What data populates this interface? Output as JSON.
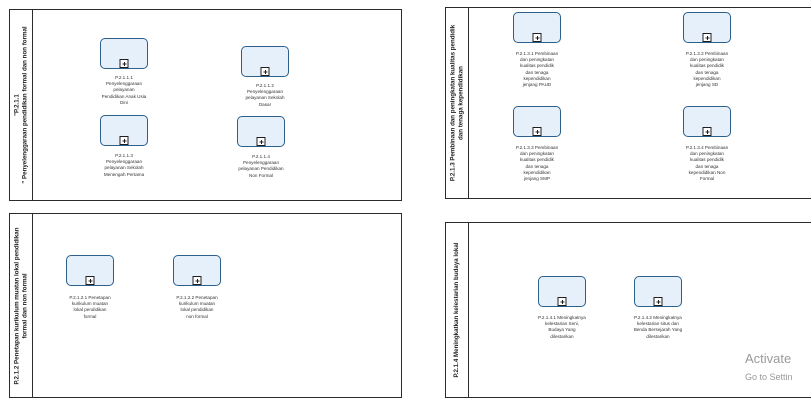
{
  "pools": [
    {
      "label": "\"P.2.1.1\n\" Penyelenggaraan pendidikan formal dan non formal",
      "tasks": [
        "P.2.1.1.1\nPenyelenggaraan\npelayanan\nPendidikan Anak Usia\nDini",
        "P.2.1.1.2\nPenyelenggaraan\npelayanan Sekolah\nDasar",
        "P.2.1.1.3\nPenyelenggaraan\npelayanan Sekolah\nMenengah Pertama",
        "P.2.1.1.4\nPenyelenggaraan\npelayanan Pendidikan\nNon Formal"
      ]
    },
    {
      "label": "P.2.1.3 Pembinaan dan peningkatan kualitas pendidik\ndan tenaga kependidikan",
      "tasks": [
        "P.2.1.3.1 Pembinaan\ndan peningkatan\nkualitas pendidik\ndan tenaga\nkependidikan\njenjang PAUD",
        "P.2.1.3.2 Pembinaan\ndan peningkatan\nkualitas pendidik\ndan tenaga\nkependidikan\njenjang SD",
        "P.2.1.3.3 Pembinaan\ndan peningkatan\nkualitas pendidik\ndan tenaga\nkependidikan\njenjang SMP",
        "P.2.1.3.4 Pembinaan\ndan peningkatan\nkualitas pendidik\ndan tenaga\nkependidikan Non\nFormal"
      ]
    },
    {
      "label": "P.2.1.2 Penetapan kurikulum muatan lokal pendidikan\nformal dan non formal",
      "tasks": [
        "P.2.1.2.1 Penetapan\nkurikulum muatan\nlokal pendidikan\nformal",
        "P.2.1.2.2 Penetapan\nkurikulum muatan\nlokal pendidikan\nnon formal"
      ]
    },
    {
      "label": "P.2.1.4 Meningkatkan kelestarian budaya lokal",
      "tasks": [
        "P.2.1.4.1 Meningkatnya\nkelestarian Seni,\nBudaya Yang\ndilestarikan",
        "P.2.1.4.2 Meningkatnya\nkelestarian situs dan\nBenda Bersejarah Yang\ndilestarikan"
      ]
    }
  ],
  "watermark": {
    "line1": "Activate",
    "line2": "Go to Settin"
  }
}
